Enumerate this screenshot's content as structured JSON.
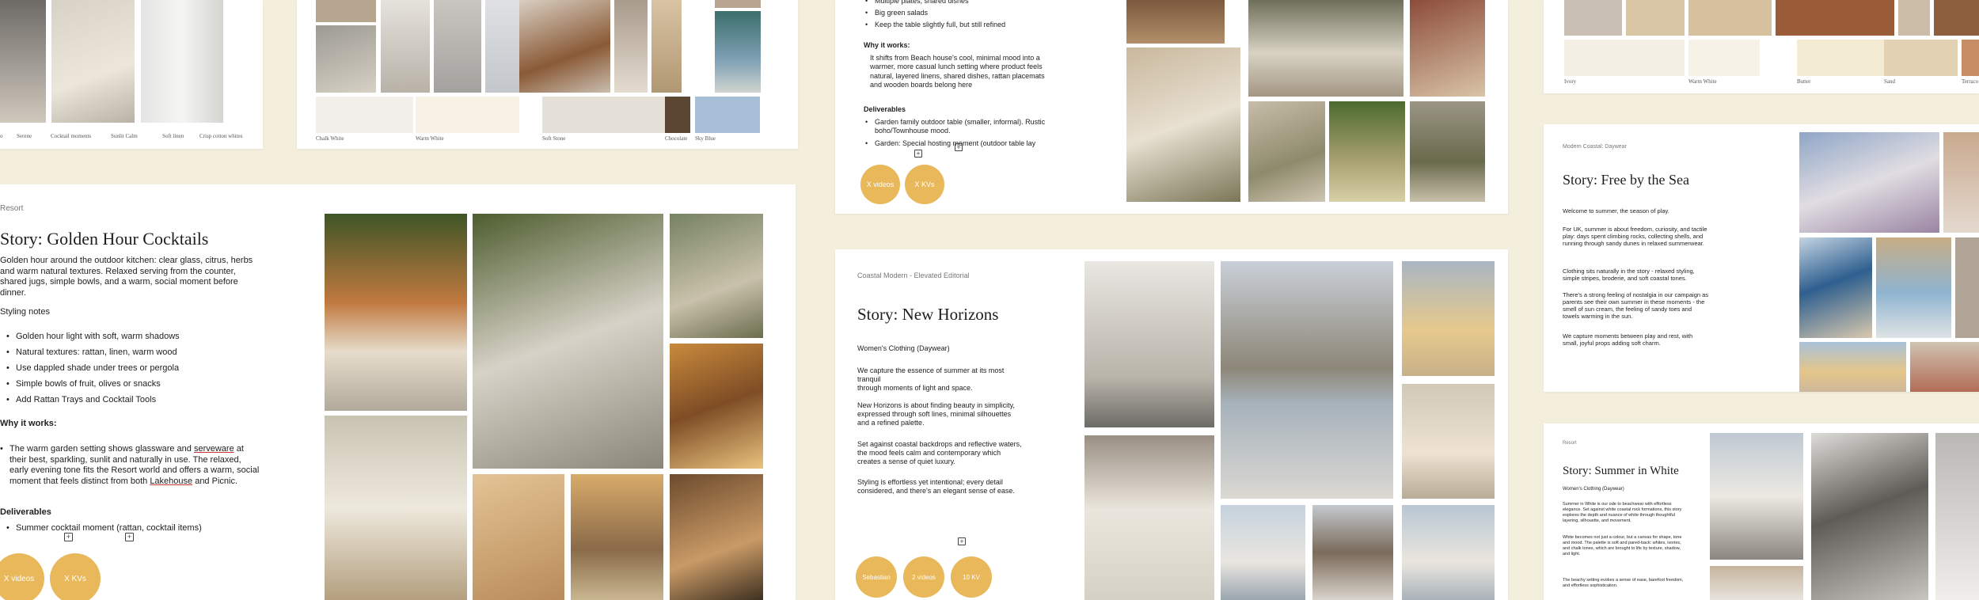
{
  "board_tl": {
    "swatch_labels": [
      "o",
      "Serene",
      "Cocktail moments",
      "Sunlit Calm",
      "Soft linen",
      "Crisp cotton whites"
    ]
  },
  "board_tm": {
    "swatch_labels": [
      "Chalk White",
      "Warm White",
      "Soft Stone",
      "Chocolate",
      "Sky Blue"
    ]
  },
  "board_tr": {
    "bullets_top": [
      "Multiple plates, shared dishes",
      "Big green salads",
      "Keep the table slightly full, but still refined"
    ],
    "why_heading": "Why it works:",
    "why_text": "It shifts from Beach house's cool, minimal mood into a warmer, more casual lunch setting where product feels natural, layered linens, shared dishes, rattan placemats and wooden boards belong here",
    "deliverables_heading": "Deliverables",
    "deliverables": [
      "Garden family outdoor table (smaller, informal). Rustic boho/Townhouse mood.",
      "Garden: Special hosting moment (outdoor table lay"
    ],
    "circles": [
      "X videos",
      "X KVs"
    ]
  },
  "board_far_tr": {
    "swatch_labels": [
      "Ivory",
      "Warm White",
      "Butter",
      "Sand",
      "Terraco"
    ]
  },
  "golden_hour": {
    "kicker": "Resort",
    "title": "Story: Golden Hour Cocktails",
    "intro": "Golden hour around the outdoor kitchen: clear glass, citrus, herbs and warm natural textures. Relaxed serving from the counter, shared jugs, simple bowls, and a warm, social moment before dinner.",
    "styling_heading": "Styling notes",
    "styling_notes": [
      "Golden hour light with soft, warm shadows",
      "Natural textures: rattan, linen, warm wood",
      "Use dappled shade under trees or pergola",
      "Simple bowls of fruit, olives or snacks",
      "Add Rattan Trays and Cocktail Tools"
    ],
    "why_heading": "Why it works:",
    "why_text_parts": [
      "The warm garden setting shows glassware and ",
      "serveware",
      " at their best, sparkling, sunlit and naturally in use. The relaxed, early evening tone fits the Resort world and offers a warm, social moment that feels distinct from both ",
      "Lakehouse",
      " and Picnic."
    ],
    "deliverables_heading": "Deliverables",
    "deliverables": [
      "Summer cocktail moment (rattan, cocktail items)"
    ],
    "circles": [
      "X videos",
      "X KVs"
    ]
  },
  "new_horizons": {
    "kicker": "Coastal Modern - Elevated Editorial",
    "title": "Story: New Horizons",
    "subtitle": "Women's Clothing (Daywear)",
    "paragraphs": [
      "We capture the essence of summer at its most tranquil\nthrough moments of light and space.",
      "New Horizons is about finding beauty in simplicity, expressed through soft lines, minimal silhouettes and a refined palette.",
      "Set against coastal backdrops and reflective waters, the mood feels calm and contemporary which creates a sense of quiet luxury.",
      "Styling is effortless yet intentional; every detail considered, and there's an elegant sense of ease."
    ],
    "circles": [
      "Sebastian",
      "2 videos",
      "10 KV"
    ]
  },
  "free_by_sea": {
    "kicker": "Modern Coastal: Daywear",
    "title": "Story: Free by the Sea",
    "paragraphs": [
      "Welcome to summer, the season of play.",
      "For UK, summer is about freedom, curiosity, and tactile play: days spent climbing rocks, collecting shells, and running through sandy dunes in relaxed summerwear.",
      "Clothing sits naturally in the story - relaxed styling, simple stripes, broderie, and soft coastal tones.",
      "There's a strong feeling of nostalgia in our campaign as parents see their own summer in these moments - the smell of sun cream, the feeling of sandy toes and towels warming in the sun.",
      "We capture moments between play and rest, with small, joyful props adding soft charm."
    ]
  },
  "summer_white": {
    "kicker": "Resort",
    "title": "Story: Summer in White",
    "subtitle": "Women's Clothing (Daywear)",
    "paragraphs": [
      "Summer in White is our ode to beachwear with effortless elegance. Set against white coastal rock formations, this story explores the depth and nuance of white through thoughtful layering, silhouette, and movement.",
      "White becomes not just a colour, but a canvas for shape, tone and mood. The palette is soft and pared-back: whites, ivories, and chalk tones, which are brought to life by texture, shadow, and light.",
      "The beachy setting evokes a sense of ease, barefoot freedom, and effortless sophistication."
    ]
  },
  "colors": {
    "background": "#f4eedc",
    "accent_circle": "#e8b85a"
  }
}
